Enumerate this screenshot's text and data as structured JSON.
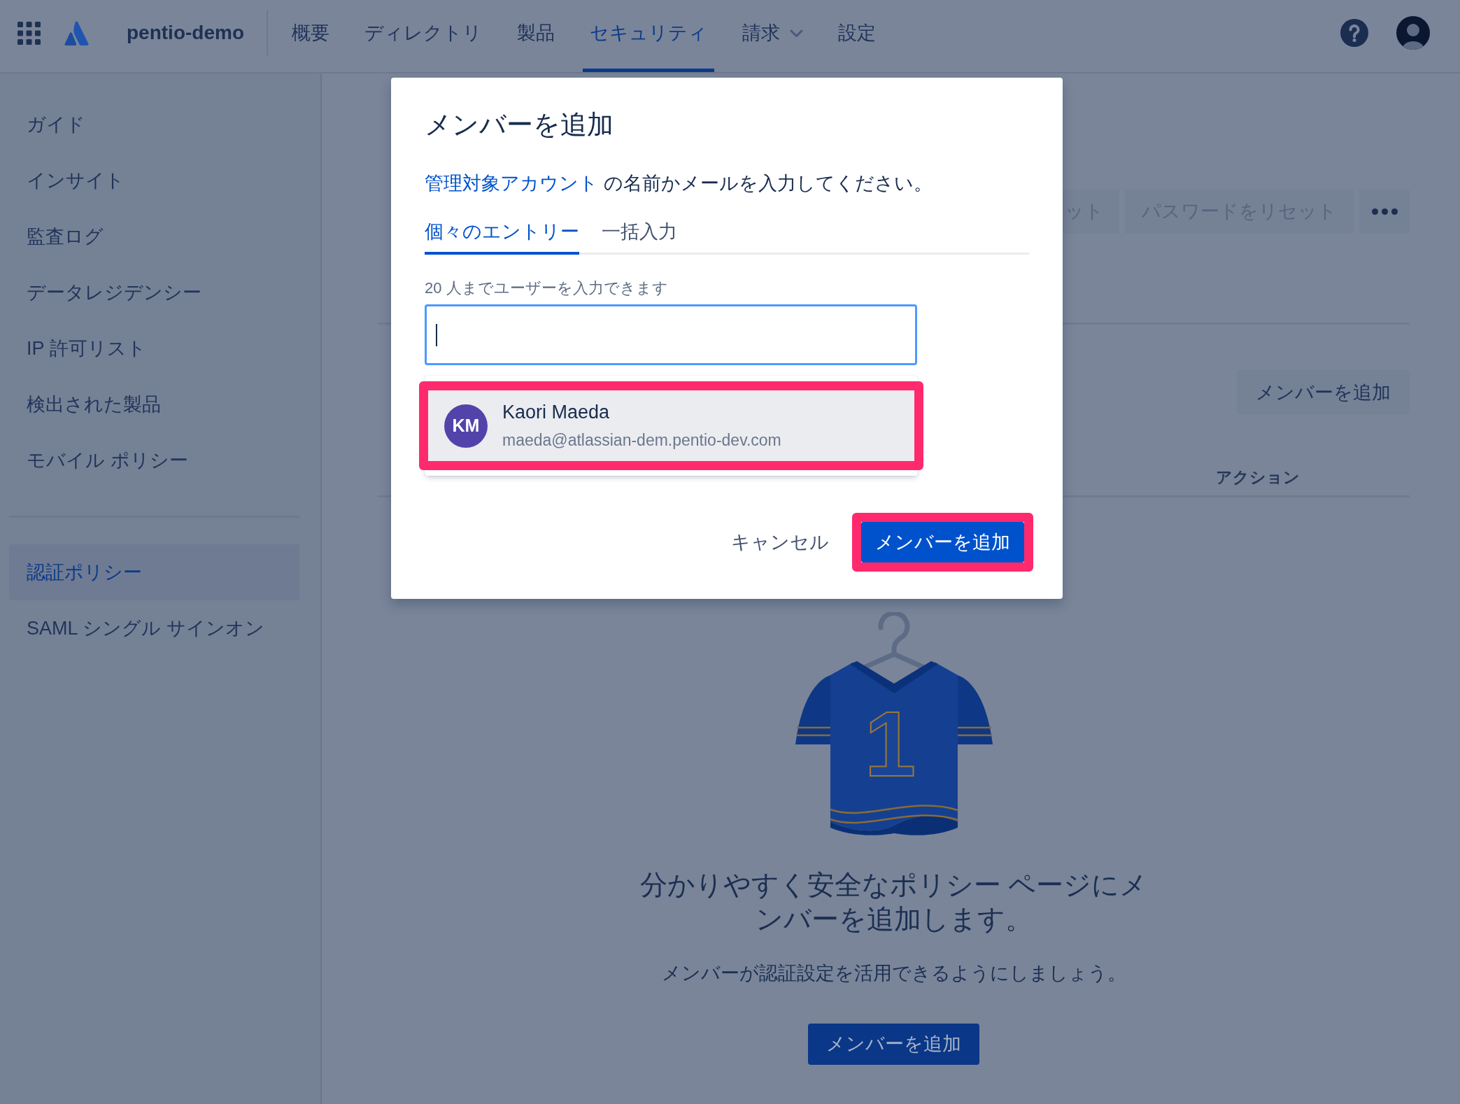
{
  "top_nav": {
    "site_name": "pentio-demo",
    "items": [
      {
        "label": "概要",
        "selected": false,
        "has_menu": false
      },
      {
        "label": "ディレクトリ",
        "selected": false,
        "has_menu": false
      },
      {
        "label": "製品",
        "selected": false,
        "has_menu": false
      },
      {
        "label": "セキュリティ",
        "selected": true,
        "has_menu": false
      },
      {
        "label": "請求",
        "selected": false,
        "has_menu": true
      },
      {
        "label": "設定",
        "selected": false,
        "has_menu": false
      }
    ]
  },
  "sidebar": {
    "groups": [
      {
        "items": [
          {
            "label": "ガイド",
            "selected": false
          },
          {
            "label": "インサイト",
            "selected": false
          },
          {
            "label": "監査ログ",
            "selected": false
          },
          {
            "label": "データレジデンシー",
            "selected": false
          },
          {
            "label": "IP 許可リスト",
            "selected": false
          },
          {
            "label": "検出された製品",
            "selected": false
          },
          {
            "label": "モバイル ポリシー",
            "selected": false
          }
        ]
      },
      {
        "items": [
          {
            "label": "認証ポリシー",
            "selected": true
          },
          {
            "label": "SAML シングル サインオン",
            "selected": false
          }
        ]
      }
    ]
  },
  "page": {
    "header_buttons": [
      {
        "kind": "clipped",
        "label": "ット",
        "disabled": true
      },
      {
        "kind": "text",
        "label": "パスワードをリセット",
        "disabled": true
      },
      {
        "kind": "more"
      }
    ],
    "members": {
      "add_button": "メンバーを追加"
    },
    "table": {
      "columns": [
        "アクション"
      ]
    },
    "empty_state": {
      "jersey_number": "1",
      "heading": "分かりやすく安全なポリシー ページにメンバーを追加します。",
      "text": "メンバーが認証設定を活用できるようにしましょう。",
      "button": "メンバーを追加"
    }
  },
  "modal": {
    "title": "メンバーを追加",
    "description": {
      "link": "管理対象アカウント",
      "text": "の名前かメールを入力してください。"
    },
    "tabs": [
      {
        "label": "個々のエントリー",
        "selected": true
      },
      {
        "label": "一括入力",
        "selected": false
      }
    ],
    "field": {
      "label": "20 人までユーザーを入力できます",
      "focused": true
    },
    "suggestions": [
      {
        "initials": "KM",
        "name": "Kaori Maeda",
        "email": "maeda@atlassian-dem.pentio-dev.com",
        "highlighted": true,
        "annotated": true
      }
    ],
    "buttons": [
      {
        "kind": "subtle",
        "label": "キャンセル",
        "annotated": false
      },
      {
        "kind": "primary",
        "label": "メンバーを追加",
        "annotated": true
      }
    ]
  }
}
